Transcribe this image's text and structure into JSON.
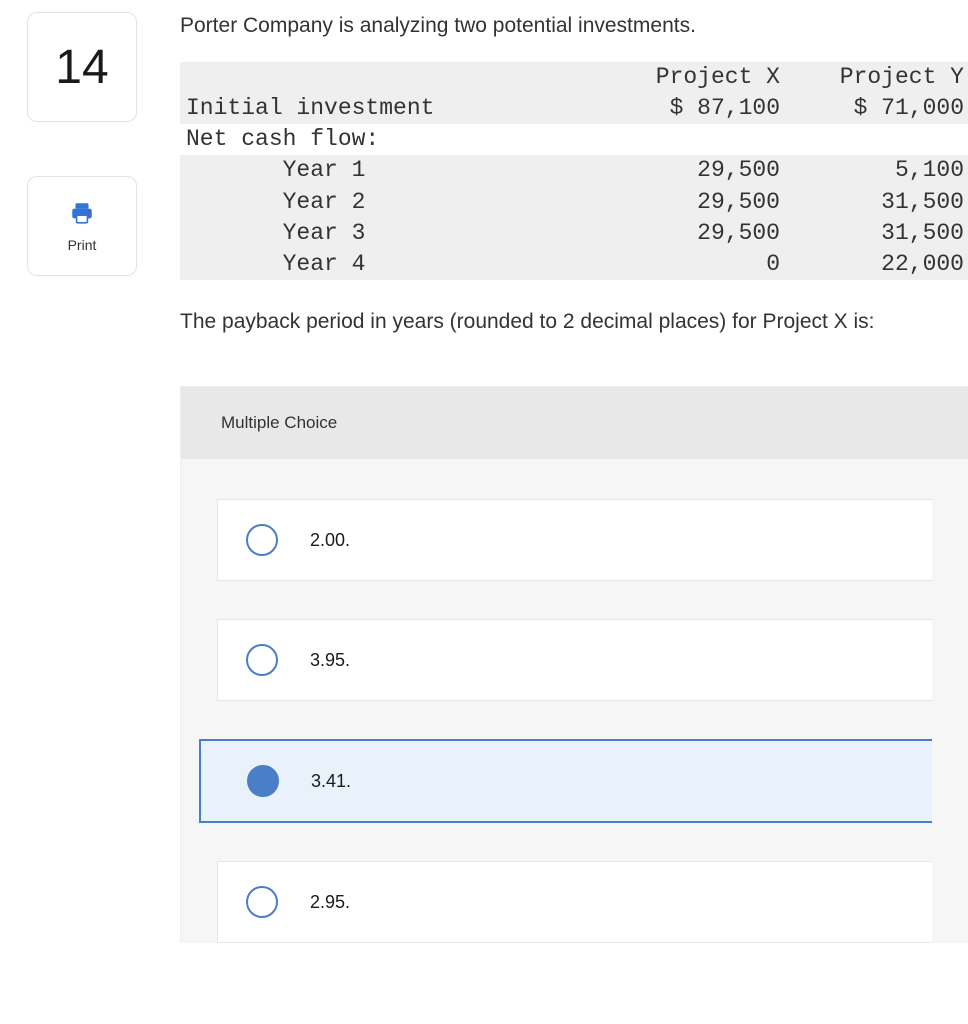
{
  "left": {
    "question_number": "14",
    "print_label": "Print"
  },
  "content": {
    "intro": "Porter Company is analyzing two potential investments.",
    "question": "The payback period in years (rounded to 2 decimal places) for Project X is:"
  },
  "table": {
    "headers": {
      "col1": "Project X",
      "col2": "Project Y"
    },
    "rows": [
      {
        "label": "Initial investment",
        "col1": "$ 87,100",
        "col2": "$ 71,000"
      },
      {
        "label": "Net cash flow:",
        "col1": "",
        "col2": ""
      },
      {
        "label": "       Year 1",
        "col1": "29,500",
        "col2": "5,100"
      },
      {
        "label": "       Year 2",
        "col1": "29,500",
        "col2": "31,500"
      },
      {
        "label": "       Year 3",
        "col1": "29,500",
        "col2": "31,500"
      },
      {
        "label": "       Year 4",
        "col1": "0",
        "col2": "22,000"
      }
    ]
  },
  "mc": {
    "title": "Multiple Choice",
    "options": [
      {
        "text": "2.00.",
        "selected": false
      },
      {
        "text": "3.95.",
        "selected": false
      },
      {
        "text": "3.41.",
        "selected": true
      },
      {
        "text": "2.95.",
        "selected": false
      }
    ]
  }
}
